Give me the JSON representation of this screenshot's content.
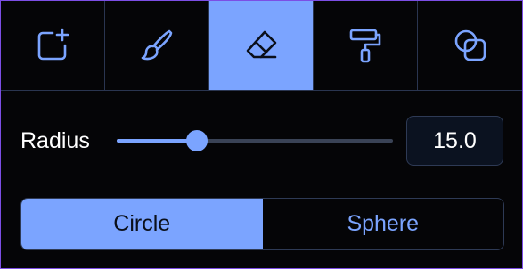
{
  "toolbar": {
    "tools": [
      {
        "icon": "add-layer-icon",
        "active": false
      },
      {
        "icon": "brush-icon",
        "active": false
      },
      {
        "icon": "eraser-icon",
        "active": true
      },
      {
        "icon": "paint-roller-icon",
        "active": false
      },
      {
        "icon": "overlap-squares-icon",
        "active": false
      }
    ]
  },
  "radius": {
    "label": "Radius",
    "value": "15.0",
    "slider_fraction": 0.29
  },
  "shape_toggle": {
    "options": [
      {
        "label": "Circle",
        "active": true
      },
      {
        "label": "Sphere",
        "active": false
      }
    ]
  },
  "colors": {
    "accent": "#7ba4ff",
    "background": "#050507",
    "border": "#2a3550",
    "frame": "#7c4ee4"
  }
}
